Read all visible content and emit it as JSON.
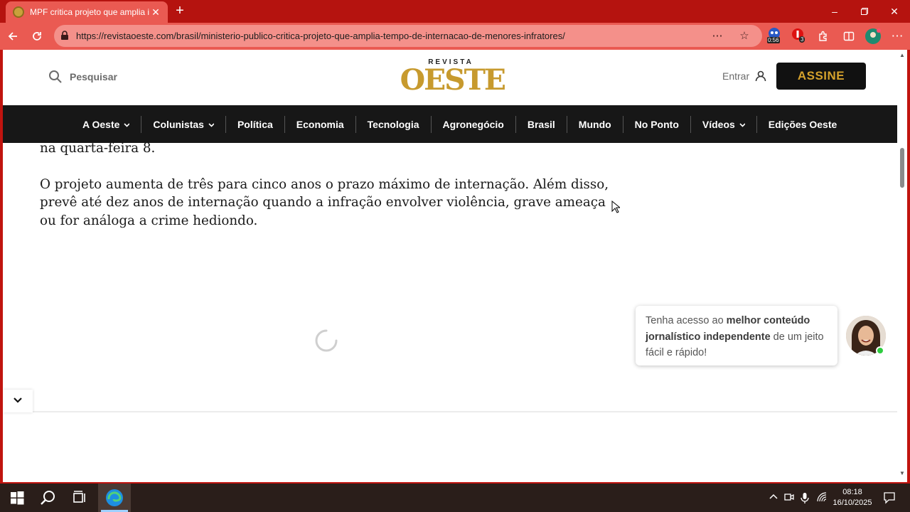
{
  "browser": {
    "tab_title": "MPF critica projeto que amplia int",
    "url": "https://revistaoeste.com/brasil/ministerio-publico-critica-projeto-que-amplia-tempo-de-internacao-de-menores-infratores/",
    "extension_badge_timer": "0:56",
    "extension_badge_count": "3",
    "accent_color": "#ea5a52"
  },
  "site": {
    "search_label": "Pesquisar",
    "logo_top": "REVISTA",
    "logo_main": "OESTE",
    "login_label": "Entrar",
    "subscribe_label": "ASSINE",
    "brand_color": "#c79a2e"
  },
  "nav": {
    "items": [
      {
        "label": "A Oeste",
        "dropdown": true
      },
      {
        "label": "Colunistas",
        "dropdown": true
      },
      {
        "label": "Política",
        "dropdown": false
      },
      {
        "label": "Economia",
        "dropdown": false
      },
      {
        "label": "Tecnologia",
        "dropdown": false
      },
      {
        "label": "Agronegócio",
        "dropdown": false
      },
      {
        "label": "Brasil",
        "dropdown": false
      },
      {
        "label": "Mundo",
        "dropdown": false
      },
      {
        "label": "No Ponto",
        "dropdown": false
      },
      {
        "label": "Vídeos",
        "dropdown": true
      },
      {
        "label": "Edições Oeste",
        "dropdown": false
      }
    ]
  },
  "article": {
    "partial_line": "na quarta-feira 8.",
    "paragraph": "O projeto aumenta de três para cinco anos o prazo máximo de internação. Além disso, prevê até dez anos de internação quando a infração envolver violência, grave ameaça ou for análoga a crime hediondo."
  },
  "chat": {
    "text_before": "Tenha acesso ao ",
    "text_bold": "melhor conteúdo jornalístico independente",
    "text_after": " de um jeito fácil e rápido!"
  },
  "taskbar": {
    "time": "08:18",
    "date": "16/10/2025"
  }
}
